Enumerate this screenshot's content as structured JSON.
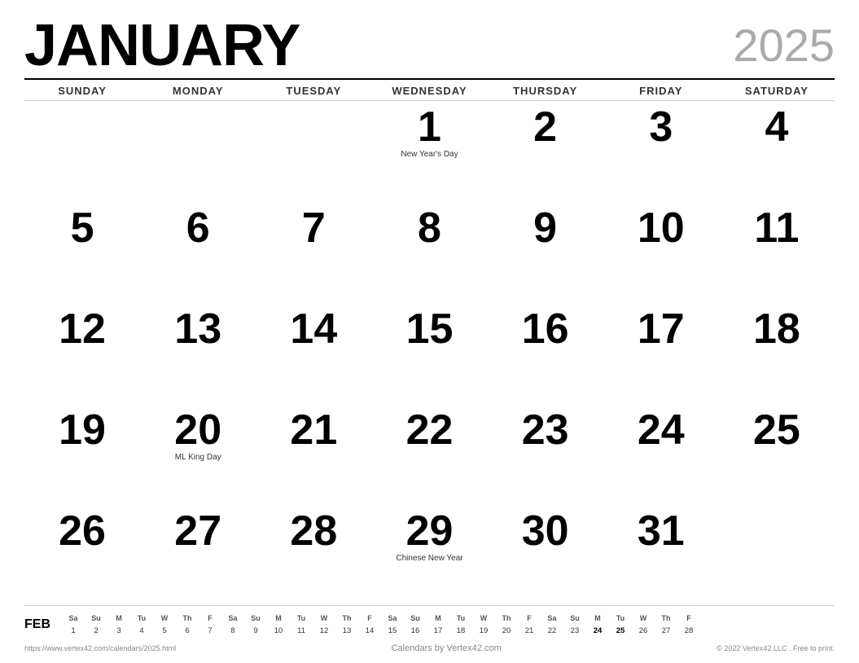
{
  "header": {
    "month": "JANUARY",
    "year": "2025"
  },
  "day_headers": [
    "SUNDAY",
    "MONDAY",
    "TUESDAY",
    "WEDNESDAY",
    "THURSDAY",
    "FRIDAY",
    "SATURDAY"
  ],
  "weeks": [
    [
      {
        "date": "",
        "event": ""
      },
      {
        "date": "",
        "event": ""
      },
      {
        "date": "",
        "event": ""
      },
      {
        "date": "1",
        "event": "New Year's Day"
      },
      {
        "date": "2",
        "event": ""
      },
      {
        "date": "3",
        "event": ""
      },
      {
        "date": "4",
        "event": ""
      }
    ],
    [
      {
        "date": "5",
        "event": ""
      },
      {
        "date": "6",
        "event": ""
      },
      {
        "date": "7",
        "event": ""
      },
      {
        "date": "8",
        "event": ""
      },
      {
        "date": "9",
        "event": ""
      },
      {
        "date": "10",
        "event": ""
      },
      {
        "date": "11",
        "event": ""
      }
    ],
    [
      {
        "date": "12",
        "event": ""
      },
      {
        "date": "13",
        "event": ""
      },
      {
        "date": "14",
        "event": ""
      },
      {
        "date": "15",
        "event": ""
      },
      {
        "date": "16",
        "event": ""
      },
      {
        "date": "17",
        "event": ""
      },
      {
        "date": "18",
        "event": ""
      }
    ],
    [
      {
        "date": "19",
        "event": ""
      },
      {
        "date": "20",
        "event": "ML King Day"
      },
      {
        "date": "21",
        "event": ""
      },
      {
        "date": "22",
        "event": ""
      },
      {
        "date": "23",
        "event": ""
      },
      {
        "date": "24",
        "event": ""
      },
      {
        "date": "25",
        "event": ""
      }
    ],
    [
      {
        "date": "26",
        "event": ""
      },
      {
        "date": "27",
        "event": ""
      },
      {
        "date": "28",
        "event": ""
      },
      {
        "date": "29",
        "event": "Chinese New Year"
      },
      {
        "date": "30",
        "event": ""
      },
      {
        "date": "31",
        "event": ""
      },
      {
        "date": "",
        "event": ""
      }
    ]
  ],
  "mini_calendar": {
    "label": "FEB",
    "headers": [
      "Sa",
      "Su",
      "M",
      "Tu",
      "W",
      "Th",
      "F",
      "Sa",
      "Su",
      "M",
      "Tu",
      "W",
      "Th",
      "F",
      "Sa",
      "Su",
      "M",
      "Tu",
      "W",
      "Th",
      "F",
      "Sa",
      "Su",
      "M",
      "Tu",
      "W",
      "Th",
      "F"
    ],
    "dates": [
      "1",
      "2",
      "3",
      "4",
      "5",
      "6",
      "7",
      "8",
      "9",
      "10",
      "11",
      "12",
      "13",
      "14",
      "15",
      "16",
      "17",
      "18",
      "19",
      "20",
      "21",
      "22",
      "23",
      "24",
      "25",
      "26",
      "27",
      "28"
    ],
    "bold": [
      "24",
      "25"
    ]
  },
  "footer": {
    "left": "https://www.vertex42.com/calendars/2025.html",
    "center": "Calendars by Vertex42.com",
    "right": "© 2022 Vertex42 LLC . Free to print."
  }
}
